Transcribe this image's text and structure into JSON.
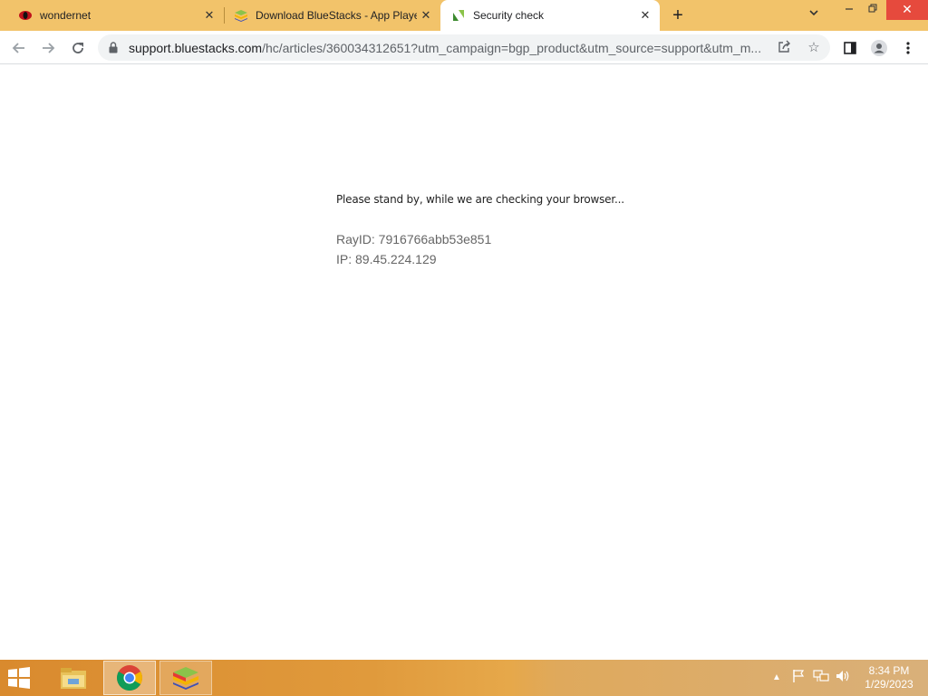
{
  "browser": {
    "tabs": [
      {
        "title": "wondernet",
        "favicon": "wondernet-eye-icon"
      },
      {
        "title": "Download BlueStacks - App Player",
        "favicon": "bluestacks-icon"
      },
      {
        "title": "Security check",
        "favicon": "zendesk-icon",
        "active": true
      }
    ],
    "new_tab_label": "+",
    "url_host": "support.bluestacks.com",
    "url_path": "/hc/articles/360034312651?utm_campaign=bgp_product&utm_source=support&utm_m..."
  },
  "page": {
    "standby_text": "Please stand by, while we are checking your browser...",
    "ray_id_text": "RayID: 7916766abb53e851",
    "ip_text": "IP: 89.45.224.129"
  },
  "taskbar": {
    "time": "8:34 PM",
    "date": "1/29/2023"
  },
  "colors": {
    "tabstrip": "#f2c36a",
    "close_button": "#e64a3d",
    "taskbar": "#e09a3c"
  }
}
